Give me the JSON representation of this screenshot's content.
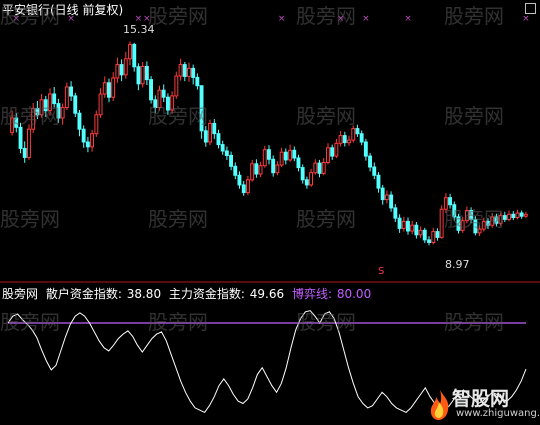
{
  "header": {
    "title": "平安银行(日线 前复权)"
  },
  "price_labels": {
    "high": "15.34",
    "low": "8.97",
    "signal": "S"
  },
  "indicator_bar": {
    "name": "股旁网",
    "retail_label": "散户资金指数:",
    "retail_value": "38.80",
    "main_label": "主力资金指数:",
    "main_value": "49.66",
    "game_label": "博弈线:",
    "game_value": "80.00"
  },
  "watermark": "股旁网",
  "logo": {
    "text": "智股网",
    "url": "www.zhiguwang.com"
  },
  "colors": {
    "up": "#ff3b3b",
    "down": "#54ffff",
    "text": "#ffffff",
    "divider": "#b01818",
    "game_line": "#c25fff",
    "marker": "#c24dc2",
    "indicator": "#ffffff"
  },
  "icons": {
    "close": "close-icon",
    "logo": "flame-icon"
  },
  "chart_data": [
    {
      "type": "candlestick",
      "title": "平安银行(日线 前复权)",
      "ylim": [
        8.2,
        16.2
      ],
      "annotations": [
        {
          "text": "15.34",
          "kind": "high",
          "value": 15.34
        },
        {
          "text": "8.97",
          "kind": "low",
          "value": 8.97
        }
      ],
      "candles": [
        [
          12.5,
          12.95,
          13.18,
          12.4
        ],
        [
          12.95,
          12.66,
          13.1,
          12.5
        ],
        [
          12.66,
          12.0,
          12.8,
          11.85
        ],
        [
          12.0,
          11.72,
          12.22,
          11.55
        ],
        [
          11.72,
          12.6,
          12.75,
          11.64
        ],
        [
          12.6,
          13.25,
          13.42,
          12.48
        ],
        [
          13.25,
          13.05,
          13.48,
          12.92
        ],
        [
          13.05,
          13.52,
          13.7,
          12.96
        ],
        [
          13.52,
          13.18,
          13.64,
          12.98
        ],
        [
          13.18,
          13.7,
          13.88,
          13.02
        ],
        [
          13.7,
          13.4,
          13.92,
          13.28
        ],
        [
          13.4,
          12.95,
          13.55,
          12.8
        ],
        [
          12.95,
          13.28,
          13.4,
          12.74
        ],
        [
          13.28,
          13.92,
          14.06,
          13.2
        ],
        [
          13.92,
          13.64,
          14.1,
          13.48
        ],
        [
          13.64,
          13.1,
          13.74,
          12.98
        ],
        [
          13.1,
          12.6,
          13.2,
          12.38
        ],
        [
          12.6,
          12.2,
          12.72,
          12.02
        ],
        [
          12.2,
          12.05,
          12.36,
          11.88
        ],
        [
          12.05,
          12.46,
          12.58,
          11.9
        ],
        [
          12.46,
          13.05,
          13.18,
          12.36
        ],
        [
          13.05,
          13.7,
          13.88,
          12.96
        ],
        [
          13.7,
          14.05,
          14.25,
          13.58
        ],
        [
          14.05,
          13.6,
          14.18,
          13.44
        ],
        [
          13.6,
          14.2,
          14.38,
          13.48
        ],
        [
          14.2,
          14.62,
          14.84,
          14.05
        ],
        [
          14.62,
          14.3,
          14.78,
          14.1
        ],
        [
          14.3,
          14.8,
          15.02,
          14.18
        ],
        [
          14.8,
          15.25,
          15.34,
          14.6
        ],
        [
          15.25,
          14.55,
          15.3,
          14.4
        ],
        [
          14.55,
          14.02,
          14.66,
          13.82
        ],
        [
          14.02,
          14.56,
          14.7,
          13.9
        ],
        [
          14.56,
          14.15,
          14.72,
          13.98
        ],
        [
          14.15,
          13.52,
          14.26,
          13.4
        ],
        [
          13.52,
          13.28,
          13.66,
          13.1
        ],
        [
          13.28,
          13.82,
          13.96,
          13.18
        ],
        [
          13.82,
          13.6,
          14.0,
          13.45
        ],
        [
          13.6,
          13.2,
          13.72,
          13.05
        ],
        [
          13.2,
          13.64,
          13.78,
          13.08
        ],
        [
          13.64,
          14.26,
          14.4,
          13.55
        ],
        [
          14.26,
          14.62,
          14.8,
          14.12
        ],
        [
          14.62,
          14.25,
          14.7,
          14.1
        ],
        [
          14.25,
          14.5,
          14.68,
          14.08
        ],
        [
          14.5,
          14.22,
          14.62,
          14.0
        ],
        [
          14.22,
          13.96,
          14.34,
          13.84
        ],
        [
          13.96,
          12.55,
          13.2,
          12.3
        ],
        [
          12.55,
          12.2,
          12.7,
          12.05
        ],
        [
          12.2,
          12.78,
          12.9,
          12.1
        ],
        [
          12.78,
          12.46,
          12.92,
          12.3
        ],
        [
          12.46,
          12.12,
          12.58,
          12.0
        ],
        [
          12.12,
          11.92,
          12.24,
          11.8
        ],
        [
          11.92,
          11.78,
          12.06,
          11.64
        ],
        [
          11.78,
          11.44,
          11.9,
          11.32
        ],
        [
          11.44,
          11.16,
          11.56,
          11.04
        ],
        [
          11.16,
          10.86,
          11.28,
          10.74
        ],
        [
          10.86,
          10.62,
          10.98,
          10.52
        ],
        [
          10.62,
          11.02,
          11.14,
          10.54
        ],
        [
          11.02,
          11.52,
          11.64,
          10.96
        ],
        [
          11.52,
          11.2,
          11.66,
          11.08
        ],
        [
          11.2,
          11.46,
          11.58,
          11.1
        ],
        [
          11.46,
          11.96,
          12.08,
          11.4
        ],
        [
          11.96,
          11.66,
          12.1,
          11.5
        ],
        [
          11.66,
          11.24,
          11.78,
          11.12
        ],
        [
          11.24,
          11.48,
          11.6,
          11.16
        ],
        [
          11.48,
          11.88,
          12.02,
          11.42
        ],
        [
          11.88,
          11.64,
          12.0,
          11.5
        ],
        [
          11.64,
          11.94,
          12.12,
          11.58
        ],
        [
          11.94,
          11.7,
          12.06,
          11.6
        ],
        [
          11.7,
          11.4,
          11.8,
          11.28
        ],
        [
          11.4,
          11.02,
          11.5,
          10.9
        ],
        [
          11.02,
          10.86,
          11.12,
          10.74
        ],
        [
          10.86,
          11.24,
          11.36,
          10.8
        ],
        [
          11.24,
          11.54,
          11.66,
          11.18
        ],
        [
          11.54,
          11.22,
          11.64,
          11.1
        ],
        [
          11.22,
          11.56,
          11.7,
          11.16
        ],
        [
          11.56,
          12.02,
          12.16,
          11.5
        ],
        [
          12.02,
          11.76,
          12.12,
          11.64
        ],
        [
          11.76,
          12.16,
          12.3,
          11.7
        ],
        [
          12.16,
          12.4,
          12.55,
          12.06
        ],
        [
          12.4,
          12.18,
          12.52,
          12.06
        ],
        [
          12.18,
          12.26,
          12.4,
          12.08
        ],
        [
          12.26,
          12.62,
          12.72,
          12.18
        ],
        [
          12.62,
          12.46,
          12.74,
          12.36
        ],
        [
          12.46,
          12.2,
          12.56,
          12.1
        ],
        [
          12.2,
          11.76,
          12.3,
          11.62
        ],
        [
          11.76,
          11.42,
          11.86,
          11.28
        ],
        [
          11.42,
          11.16,
          11.56,
          11.04
        ],
        [
          11.16,
          10.76,
          11.26,
          10.62
        ],
        [
          10.76,
          10.4,
          10.86,
          10.24
        ],
        [
          10.4,
          10.54,
          10.68,
          10.28
        ],
        [
          10.54,
          10.14,
          10.66,
          10.02
        ],
        [
          10.14,
          9.82,
          10.26,
          9.7
        ],
        [
          9.82,
          9.5,
          9.94,
          9.36
        ],
        [
          9.5,
          9.72,
          9.86,
          9.4
        ],
        [
          9.72,
          9.42,
          9.84,
          9.3
        ],
        [
          9.42,
          9.6,
          9.74,
          9.32
        ],
        [
          9.6,
          9.3,
          9.7,
          9.18
        ],
        [
          9.3,
          9.44,
          9.56,
          9.2
        ],
        [
          9.44,
          9.14,
          9.52,
          9.04
        ],
        [
          9.14,
          9.06,
          9.26,
          8.97
        ],
        [
          9.06,
          9.4,
          9.52,
          9.0
        ],
        [
          9.4,
          9.22,
          9.5,
          9.12
        ],
        [
          9.22,
          10.1,
          10.22,
          9.18
        ],
        [
          10.1,
          10.46,
          10.6,
          9.98
        ],
        [
          10.46,
          10.24,
          10.58,
          10.12
        ],
        [
          10.24,
          9.86,
          10.34,
          9.74
        ],
        [
          9.86,
          9.44,
          9.96,
          9.34
        ],
        [
          9.44,
          9.74,
          9.86,
          9.36
        ],
        [
          9.74,
          10.06,
          10.18,
          9.66
        ],
        [
          10.06,
          9.78,
          10.16,
          9.66
        ],
        [
          9.78,
          9.36,
          9.88,
          9.28
        ],
        [
          9.36,
          9.48,
          9.6,
          9.26
        ],
        [
          9.48,
          9.72,
          9.84,
          9.4
        ],
        [
          9.72,
          9.6,
          9.82,
          9.48
        ],
        [
          9.6,
          9.86,
          9.98,
          9.52
        ],
        [
          9.86,
          9.66,
          9.96,
          9.56
        ],
        [
          9.66,
          9.9,
          10.0,
          9.58
        ],
        [
          9.9,
          9.78,
          10.02,
          9.7
        ],
        [
          9.78,
          9.94,
          10.06,
          9.72
        ],
        [
          9.94,
          9.84,
          10.04,
          9.76
        ],
        [
          9.84,
          9.98,
          10.08,
          9.78
        ],
        [
          9.98,
          9.88,
          10.06,
          9.8
        ],
        [
          9.88,
          9.94,
          10.02,
          9.82
        ]
      ]
    },
    {
      "type": "line",
      "title": "股旁网",
      "ylim": [
        -5,
        105
      ],
      "series": [
        {
          "name": "博弈线",
          "values": [
            80,
            80
          ]
        },
        {
          "name": "散户资金指数",
          "values": [
            80,
            86,
            88,
            83,
            79,
            74,
            67,
            56,
            46,
            38,
            42,
            55,
            68,
            79,
            86,
            89,
            86,
            80,
            72,
            64,
            58,
            55,
            60,
            66,
            70,
            73,
            68,
            60,
            54,
            60,
            66,
            70,
            72,
            64,
            52,
            40,
            28,
            18,
            10,
            4,
            2,
            0,
            6,
            14,
            24,
            30,
            24,
            16,
            10,
            8,
            12,
            22,
            34,
            40,
            32,
            24,
            18,
            26,
            40,
            58,
            74,
            84,
            90,
            91,
            86,
            80,
            88,
            90,
            84,
            72,
            56,
            40,
            26,
            14,
            8,
            4,
            6,
            12,
            18,
            14,
            8,
            4,
            2,
            0,
            4,
            10,
            16,
            22,
            14,
            8,
            4,
            2,
            6,
            12,
            18,
            20,
            16,
            12,
            8,
            10,
            14,
            18,
            16,
            12,
            10,
            14,
            20,
            28,
            38.8
          ]
        }
      ]
    }
  ]
}
